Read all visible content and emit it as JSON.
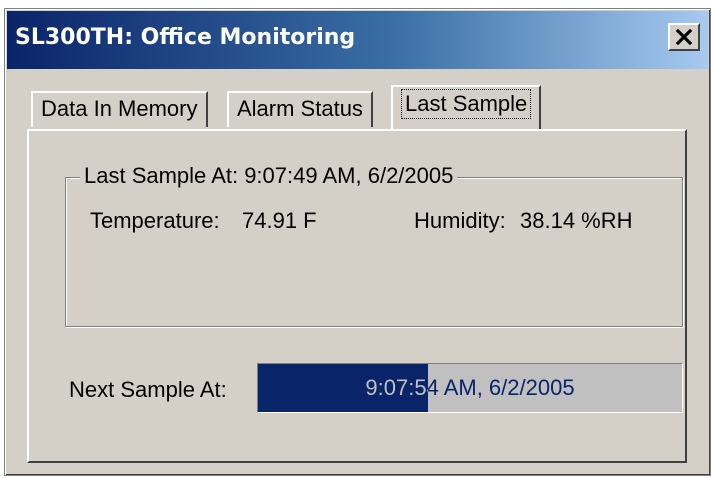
{
  "window": {
    "title": "SL300TH: Office Monitoring",
    "close_icon": "close-x-icon"
  },
  "tabs": [
    {
      "label": "Data In Memory",
      "active": false
    },
    {
      "label": "Alarm Status",
      "active": false
    },
    {
      "label": "Last Sample",
      "active": true
    }
  ],
  "last_sample": {
    "legend": "Last Sample At: 9:07:49 AM, 6/2/2005",
    "temperature_label": "Temperature:",
    "temperature_value": "74.91 F",
    "humidity_label": "Humidity:",
    "humidity_value": "38.14 %RH"
  },
  "next_sample": {
    "label": "Next Sample At:",
    "value": "9:07:54 AM, 6/2/2005",
    "progress_fraction": 0.4
  },
  "colors": {
    "title_bar_start": "#0a246a",
    "title_bar_end": "#a6caf0",
    "face": "#d4d0c8",
    "progress_fill": "#0a246a",
    "progress_track": "#c0c0c0"
  }
}
